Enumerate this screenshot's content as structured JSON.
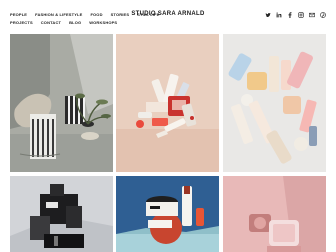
{
  "brand": {
    "title": "STUDIO SARA ARNALD"
  },
  "nav": {
    "row1": [
      "PEOPLE",
      "FASHION & LIFESTYLE",
      "FOOD",
      "STORIES",
      "STILL LIFE"
    ],
    "row2": [
      "PROJECTS",
      "CONTACT",
      "BLOG",
      "WORKSHOPS"
    ]
  },
  "social": [
    "twitter-icon",
    "linkedin-icon",
    "facebook-icon",
    "instagram-icon",
    "mail-icon",
    "pinterest-icon"
  ],
  "gallery": [
    {
      "name": "still-life-plant-vases",
      "bg": "#a7a9a3"
    },
    {
      "name": "beauty-products-peach",
      "bg": "#e7cdbd"
    },
    {
      "name": "skincare-bottles-white",
      "bg": "#e9e8e6"
    },
    {
      "name": "perfume-grey",
      "bg": "#d4d6d9"
    },
    {
      "name": "cream-jar-blue",
      "bg": "#2f5f93"
    },
    {
      "name": "compact-pink",
      "bg": "#e8b9b8"
    }
  ]
}
